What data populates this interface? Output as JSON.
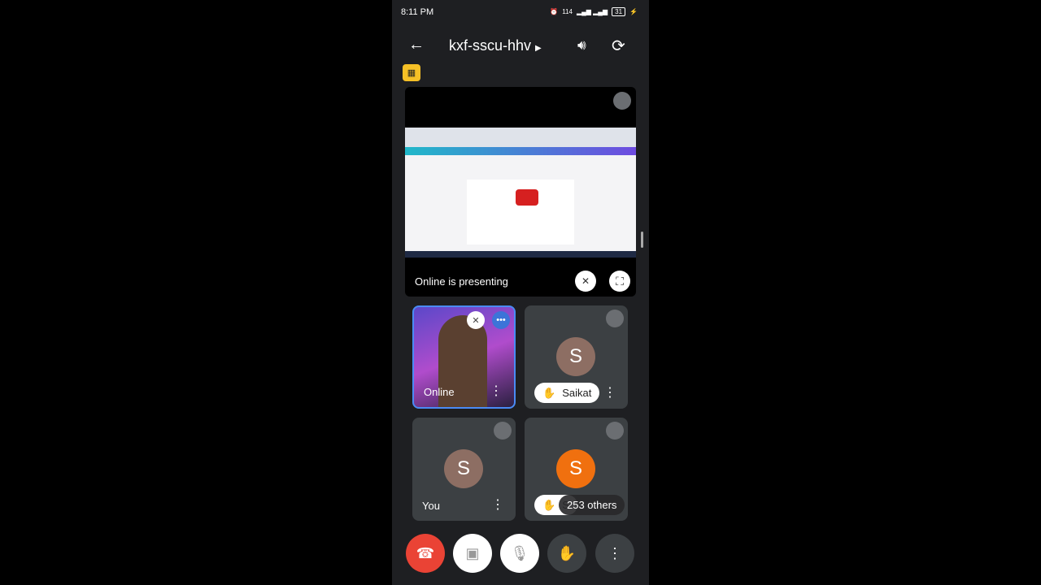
{
  "status": {
    "time": "8:11 PM",
    "speed": "114",
    "battery": "31"
  },
  "header": {
    "meeting_code": "kxf-sscu-hhv"
  },
  "presentation": {
    "label": "Online is presenting"
  },
  "participants": [
    {
      "name": "Online",
      "type": "video"
    },
    {
      "name": "Saikat",
      "initial": "S",
      "avatar_color": "#8d6e63",
      "hand_raised": true
    },
    {
      "name": "You",
      "initial": "S",
      "avatar_color": "#8d6e63"
    },
    {
      "name": "S",
      "initial": "S",
      "avatar_color": "#f0700f",
      "hand_raised": true
    }
  ],
  "others_label": "253 others",
  "controls": [
    "end-call",
    "camera-off",
    "mic-off",
    "raise-hand",
    "more"
  ],
  "colors": {
    "end_call": "#ea4335",
    "badge": "#f6c026",
    "accent": "#4a8bf5"
  }
}
